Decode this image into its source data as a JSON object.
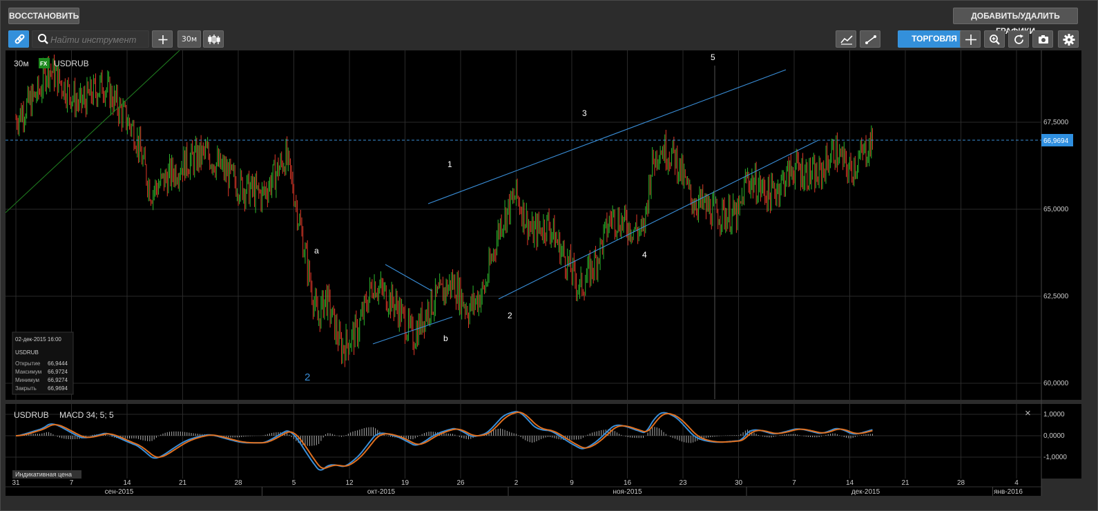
{
  "toolbar": {
    "restore_label": "ВОССТАНОВИТЬ",
    "add_remove_label": "ДОБАВИТЬ/УДАЛИТЬ ГРАФИКИ",
    "search_placeholder": "Найти инструмент",
    "timeframe_label": "30м",
    "trade_label": "ТОРГОВЛЯ"
  },
  "chart_header": {
    "timeframe": "30м",
    "fx_badge": "FX",
    "symbol": "USDRUB"
  },
  "price_axis": {
    "ticks": [
      "67,5000",
      "65,0000",
      "62,5000",
      "60,0000"
    ],
    "current_price": "66,9694",
    "current_price_color": "#2f8fe0"
  },
  "wave_labels": {
    "w1": "1",
    "w2": "2",
    "w3": "3",
    "w4": "4",
    "w5": "5",
    "wa": "a",
    "wb": "b",
    "w2_big": "2"
  },
  "info_box": {
    "datetime": "02-дек-2015 16:00",
    "symbol": "USDRUB",
    "rows": [
      {
        "label": "Открытие",
        "value": "66,9444"
      },
      {
        "label": "Максимум",
        "value": "66,9724"
      },
      {
        "label": "Минимум",
        "value": "66,9274"
      },
      {
        "label": "Закрыть",
        "value": "66,9694"
      }
    ]
  },
  "macd_panel": {
    "symbol": "USDRUB",
    "indicator": "MACD 34; 5; 5",
    "ticks": [
      "1,0000",
      "0,0000",
      "-1,0000"
    ],
    "close_icon": "×",
    "line_colors": {
      "macd": "#3a8fd9",
      "signal": "#e07020",
      "histogram": "#aaaaaa"
    }
  },
  "footer": {
    "indicative_price": "Индикативная цена",
    "day_ticks": [
      "31",
      "7",
      "14",
      "21",
      "28",
      "5",
      "12",
      "19",
      "26",
      "2",
      "9",
      "16",
      "23",
      "30",
      "7",
      "14",
      "21",
      "28",
      "4"
    ],
    "month_labels": [
      "сен-2015",
      "окт-2015",
      "ноя-2015",
      "дек-2015",
      "янв-2016"
    ]
  },
  "colors": {
    "up_candle": "#2db92d",
    "down_candle": "#e23a2a",
    "trendline": "#3a8fd9",
    "background": "#000000"
  },
  "chart_data": {
    "type": "candlestick",
    "symbol": "USDRUB",
    "timeframe": "30м",
    "x_range": [
      "2015-08-31",
      "2016-01-04"
    ],
    "y_range": [
      59.8,
      69.3
    ],
    "last_close": 66.9694,
    "price_path": [
      {
        "date": "2015-08-31",
        "price": 67.6
      },
      {
        "date": "2015-09-03",
        "price": 68.4
      },
      {
        "date": "2015-09-04",
        "price": 69.1
      },
      {
        "date": "2015-09-08",
        "price": 68.0
      },
      {
        "date": "2015-09-11",
        "price": 68.6
      },
      {
        "date": "2015-09-15",
        "price": 67.2
      },
      {
        "date": "2015-09-17",
        "price": 65.5
      },
      {
        "date": "2015-09-21",
        "price": 66.3
      },
      {
        "date": "2015-09-24",
        "price": 66.6
      },
      {
        "date": "2015-09-28",
        "price": 65.7
      },
      {
        "date": "2015-10-01",
        "price": 65.4
      },
      {
        "date": "2015-10-04",
        "price": 66.5
      },
      {
        "date": "2015-10-05",
        "price": 65.5
      },
      {
        "date": "2015-10-07",
        "price": 63.0
      },
      {
        "date": "2015-10-08",
        "price": 61.8
      },
      {
        "date": "2015-10-09",
        "price": 62.5
      },
      {
        "date": "2015-10-11",
        "price": 61.0
      },
      {
        "date": "2015-10-13",
        "price": 61.5
      },
      {
        "date": "2015-10-15",
        "price": 62.9
      },
      {
        "date": "2015-10-18",
        "price": 62.2
      },
      {
        "date": "2015-10-20",
        "price": 61.3
      },
      {
        "date": "2015-10-22",
        "price": 62.2
      },
      {
        "date": "2015-10-25",
        "price": 62.9
      },
      {
        "date": "2015-10-27",
        "price": 62.1
      },
      {
        "date": "2015-10-29",
        "price": 62.7
      },
      {
        "date": "2015-10-31",
        "price": 64.6
      },
      {
        "date": "2015-11-02",
        "price": 65.4
      },
      {
        "date": "2015-11-04",
        "price": 64.3
      },
      {
        "date": "2015-11-06",
        "price": 64.6
      },
      {
        "date": "2015-11-09",
        "price": 63.2
      },
      {
        "date": "2015-11-10",
        "price": 62.7
      },
      {
        "date": "2015-11-12",
        "price": 63.5
      },
      {
        "date": "2015-11-14",
        "price": 64.8
      },
      {
        "date": "2015-11-18",
        "price": 64.3
      },
      {
        "date": "2015-11-19",
        "price": 66.2
      },
      {
        "date": "2015-11-20",
        "price": 66.8
      },
      {
        "date": "2015-11-22",
        "price": 66.5
      },
      {
        "date": "2015-11-24",
        "price": 65.3
      },
      {
        "date": "2015-11-27",
        "price": 64.9
      },
      {
        "date": "2015-11-30",
        "price": 64.8
      },
      {
        "date": "2015-12-01",
        "price": 65.9
      },
      {
        "date": "2015-12-04",
        "price": 65.4
      },
      {
        "date": "2015-12-07",
        "price": 66.2
      },
      {
        "date": "2015-12-10",
        "price": 65.9
      },
      {
        "date": "2015-12-12",
        "price": 66.7
      },
      {
        "date": "2015-12-14",
        "price": 66.1
      },
      {
        "date": "2015-12-17",
        "price": 66.97
      }
    ],
    "macd_range": [
      -1.5,
      1.5
    ]
  }
}
